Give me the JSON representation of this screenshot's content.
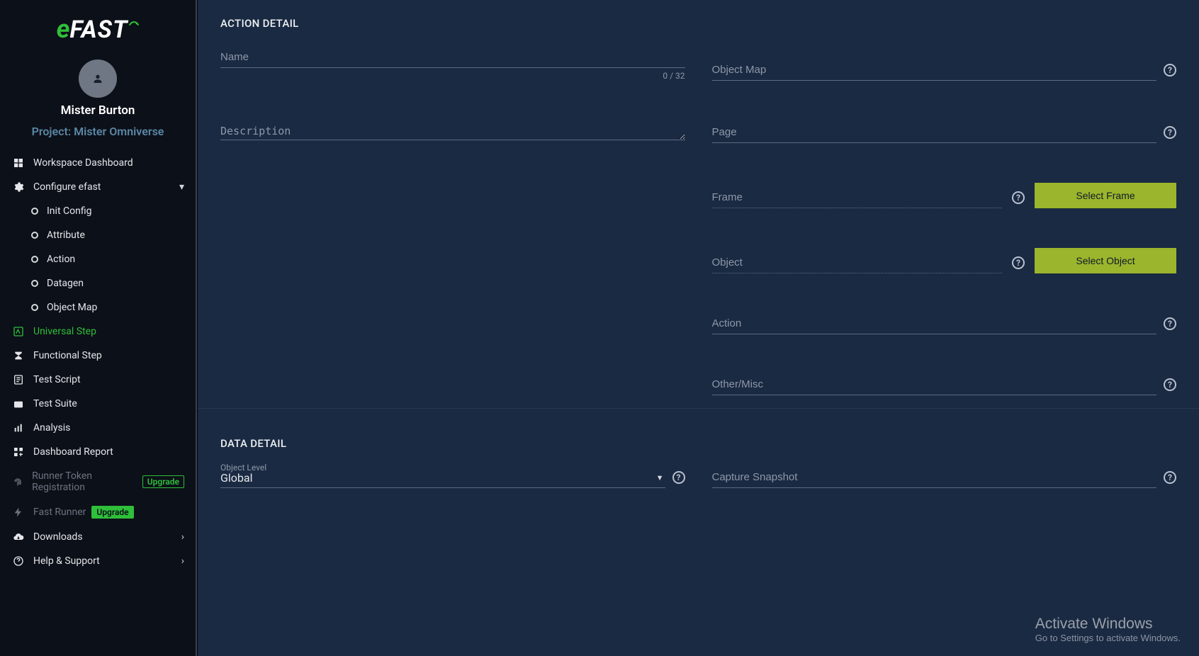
{
  "brand": {
    "e": "e",
    "fast": "FAST",
    "accent": "⤵"
  },
  "user": {
    "name": "Mister Burton",
    "project_label": "Project: Mister Omniverse"
  },
  "sidebar": {
    "items": [
      {
        "label": "Workspace Dashboard"
      },
      {
        "label": "Configure efast"
      },
      {
        "label": "Universal Step"
      },
      {
        "label": "Functional Step"
      },
      {
        "label": "Test Script"
      },
      {
        "label": "Test Suite"
      },
      {
        "label": "Analysis"
      },
      {
        "label": "Dashboard Report"
      },
      {
        "label": "Runner Token Registration"
      },
      {
        "label": "Fast Runner"
      },
      {
        "label": "Downloads"
      },
      {
        "label": "Help & Support"
      }
    ],
    "sub": [
      {
        "label": "Init Config"
      },
      {
        "label": "Attribute"
      },
      {
        "label": "Action"
      },
      {
        "label": "Datagen"
      },
      {
        "label": "Object Map"
      }
    ],
    "upgrade": "Upgrade"
  },
  "action_detail": {
    "title": "ACTION DETAIL",
    "name": {
      "placeholder": "Name",
      "counter": "0 / 32"
    },
    "description": {
      "placeholder": "Description"
    },
    "object_map": {
      "placeholder": "Object Map"
    },
    "page": {
      "placeholder": "Page"
    },
    "frame": {
      "placeholder": "Frame",
      "button": "Select Frame"
    },
    "object": {
      "placeholder": "Object",
      "button": "Select Object"
    },
    "action": {
      "placeholder": "Action"
    },
    "other": {
      "placeholder": "Other/Misc"
    }
  },
  "data_detail": {
    "title": "DATA DETAIL",
    "object_level": {
      "label": "Object Level",
      "value": "Global"
    },
    "snapshot": {
      "placeholder": "Capture Snapshot"
    }
  },
  "watermark": {
    "line1": "Activate Windows",
    "line2": "Go to Settings to activate Windows."
  }
}
